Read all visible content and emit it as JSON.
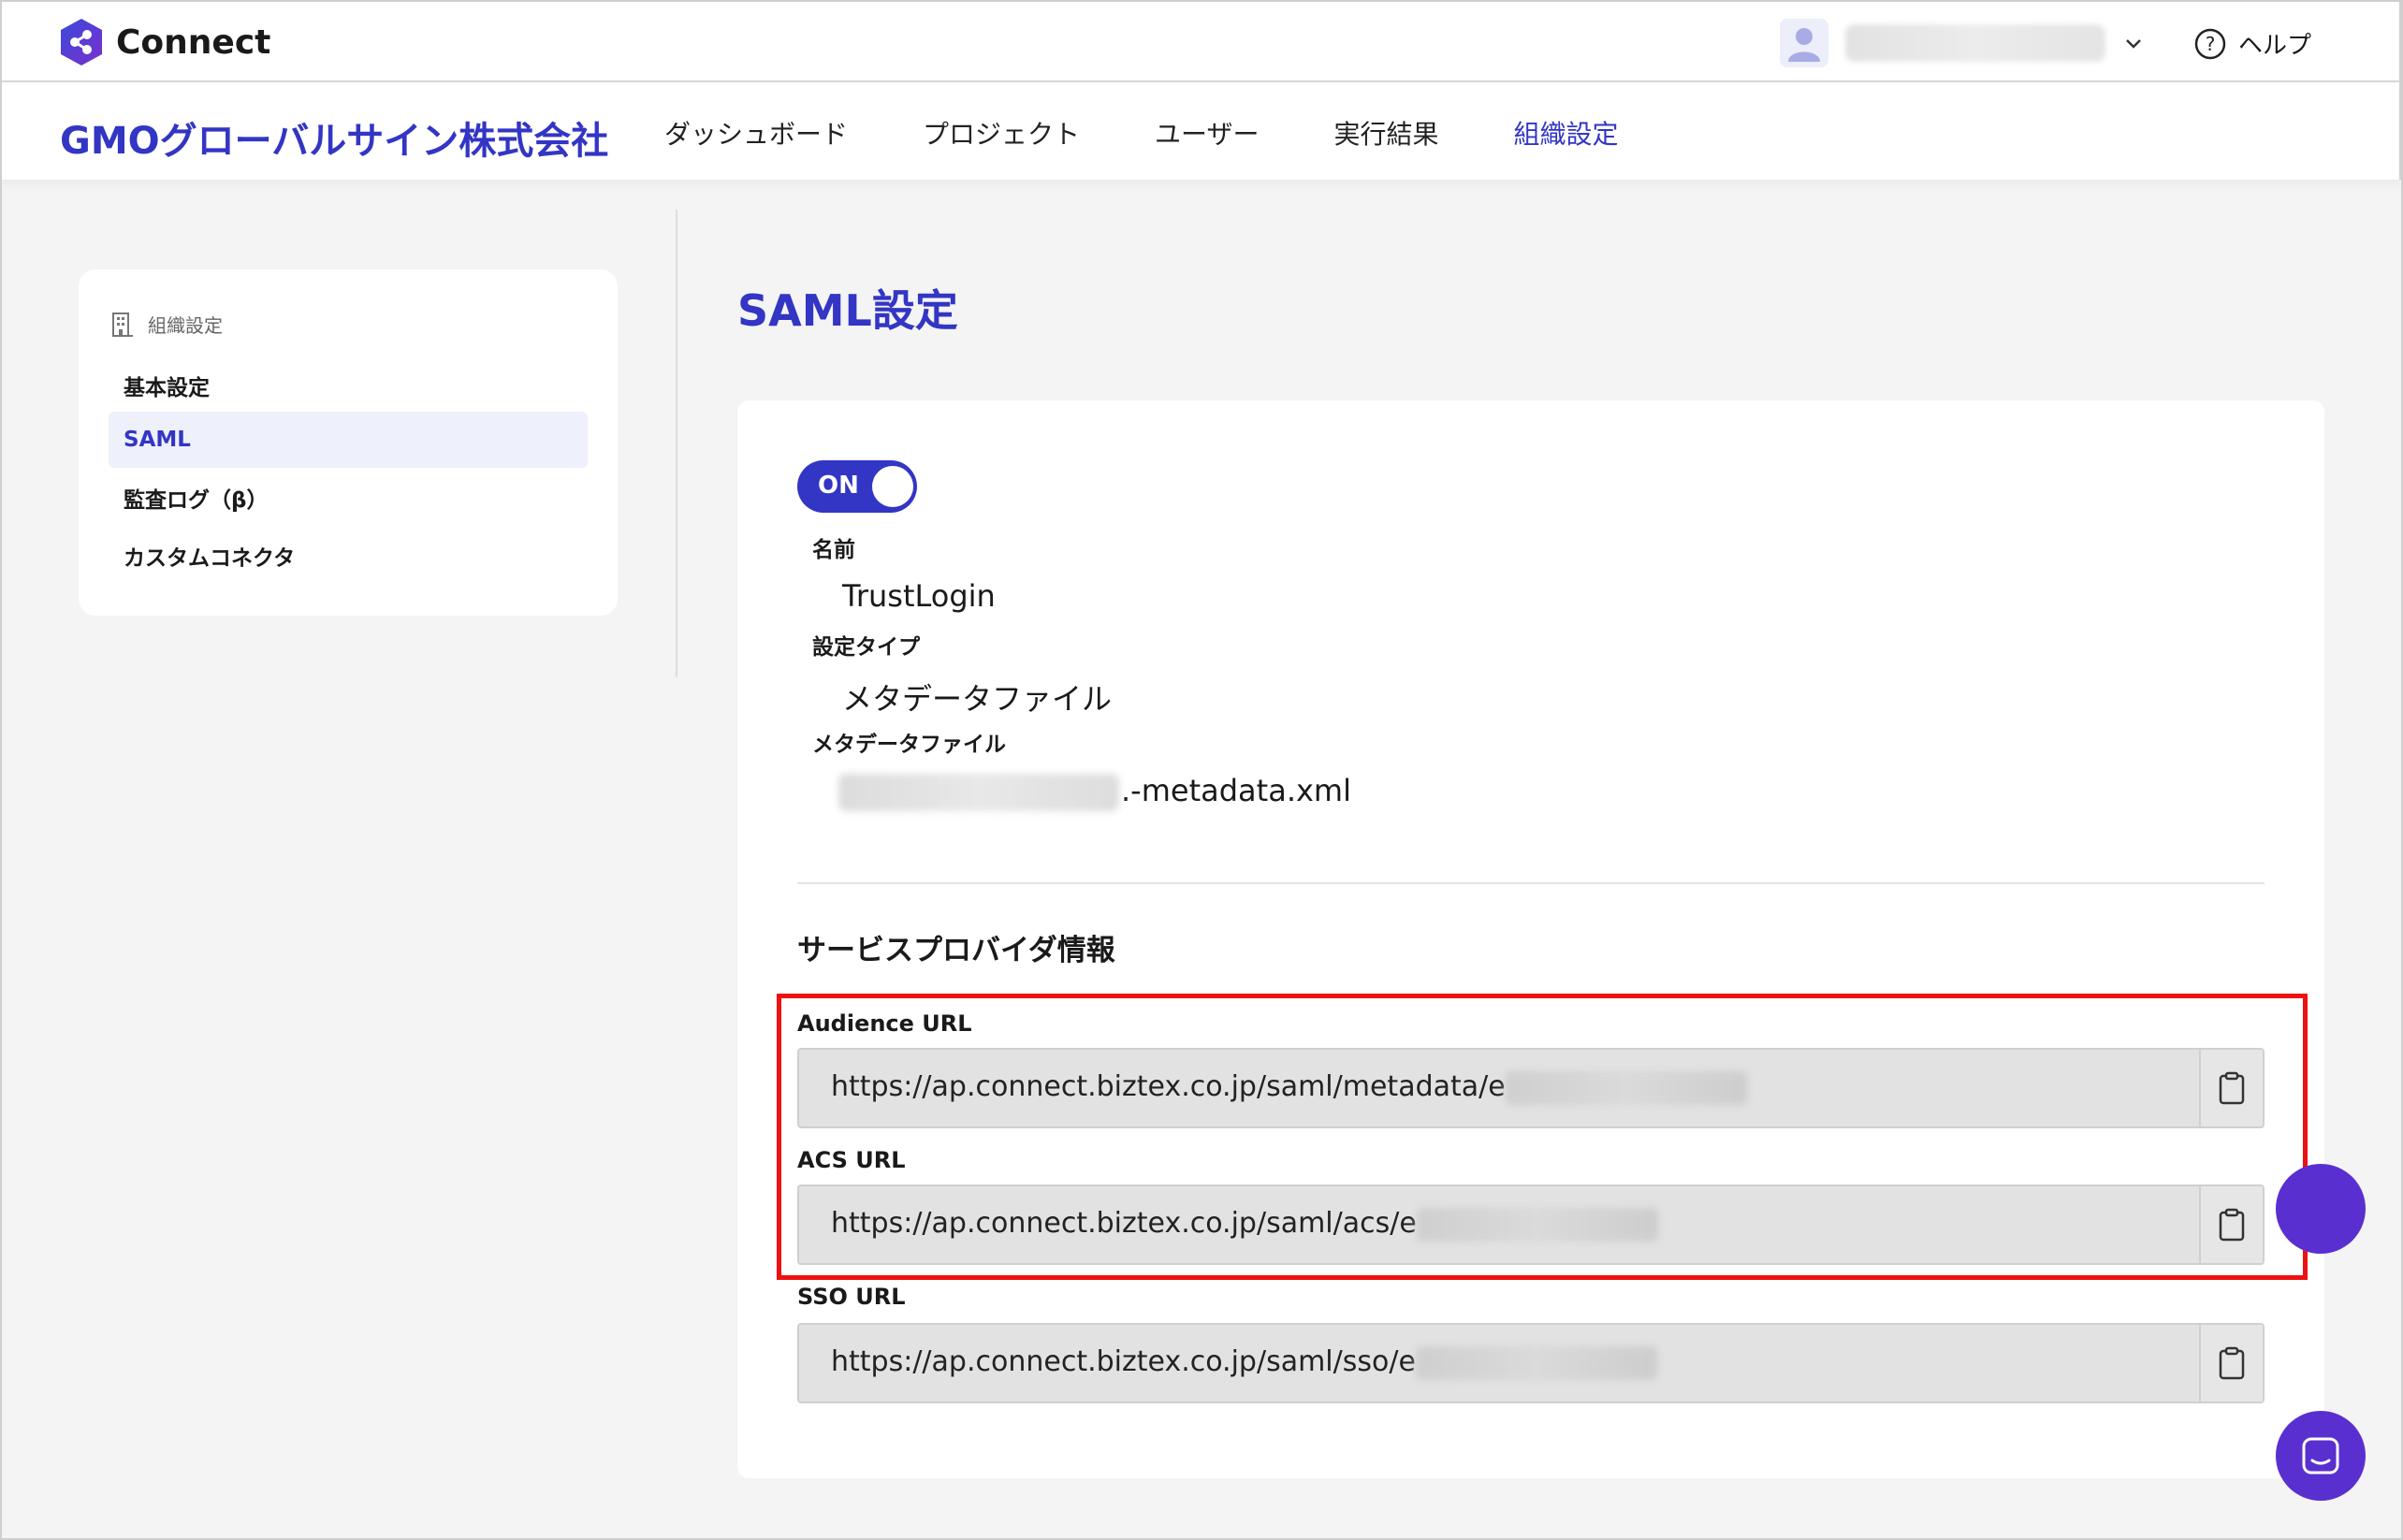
{
  "app": {
    "name": "Connect"
  },
  "header": {
    "help_label": "ヘルプ"
  },
  "nav": {
    "org_name": "GMOグローバルサイン株式会社",
    "items": [
      "ダッシュボード",
      "プロジェクト",
      "ユーザー",
      "実行結果",
      "組織設定"
    ],
    "active_index": 4
  },
  "sidebar": {
    "heading": "組織設定",
    "items": [
      "基本設定",
      "SAML",
      "監査ログ（β）",
      "カスタムコネクタ"
    ],
    "active_index": 1
  },
  "page": {
    "title": "SAML設定"
  },
  "saml": {
    "toggle_label": "ON",
    "name_label": "名前",
    "name_value": "TrustLogin",
    "type_label": "設定タイプ",
    "type_value": "メタデータファイル",
    "file_label": "メタデータファイル",
    "file_suffix": ".-metadata.xml"
  },
  "sp_info": {
    "title": "サービスプロバイダ情報",
    "audience_label": "Audience URL",
    "audience_value": "https://ap.connect.biztex.co.jp/saml/metadata/e",
    "acs_label": "ACS URL",
    "acs_value": "https://ap.connect.biztex.co.jp/saml/acs/e",
    "sso_label": "SSO URL",
    "sso_value": "https://ap.connect.biztex.co.jp/saml/sso/e"
  },
  "colors": {
    "accent": "#3335c4",
    "highlight": "#ee1111",
    "fab": "#5a2fd0"
  }
}
